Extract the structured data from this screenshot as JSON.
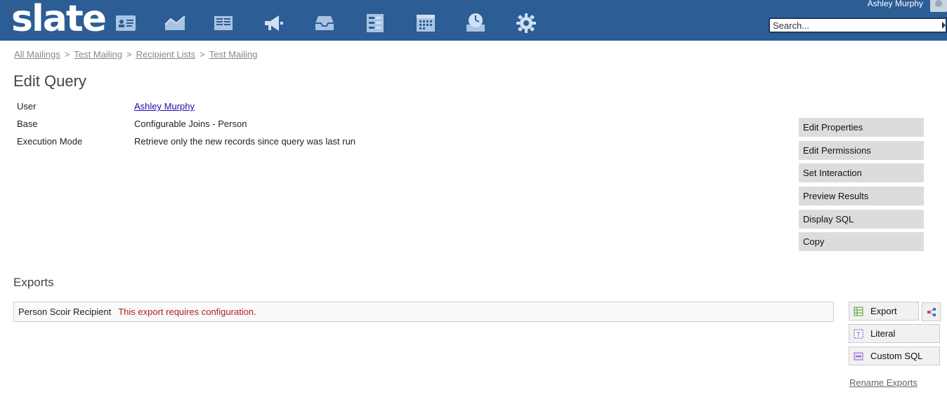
{
  "app": {
    "logo": "slate"
  },
  "header": {
    "user_name": "Ashley Murphy",
    "search_placeholder": "Search...",
    "nav_icons": [
      "records-icon",
      "reports-icon",
      "forms-icon",
      "deliver-icon",
      "inbox-icon",
      "queries-icon",
      "events-icon",
      "scheduler-icon",
      "settings-icon"
    ]
  },
  "breadcrumb": [
    "All Mailings",
    "Test Mailing",
    "Recipient Lists",
    "Test Mailing"
  ],
  "page_title": "Edit Query",
  "properties": [
    {
      "key": "User",
      "value": "Ashley Murphy"
    },
    {
      "key": "Base",
      "value": "Configurable Joins - Person"
    },
    {
      "key": "Execution Mode",
      "value": "Retrieve only the new records since query was last run"
    }
  ],
  "actions": [
    "Edit Properties",
    "Edit Permissions",
    "Set Interaction",
    "Preview Results",
    "Display SQL",
    "Copy"
  ],
  "exports": {
    "title": "Exports",
    "row_label": "Person Scoir Recipient",
    "row_warning": "This export requires configuration.",
    "buttons": {
      "export": "Export",
      "literal": "Literal",
      "custom_sql": "Custom SQL"
    },
    "rename_link": "Rename Exports"
  },
  "colors": {
    "header": "#2c5d95",
    "warning": "#b21e1e",
    "link": "#1a0dab"
  }
}
